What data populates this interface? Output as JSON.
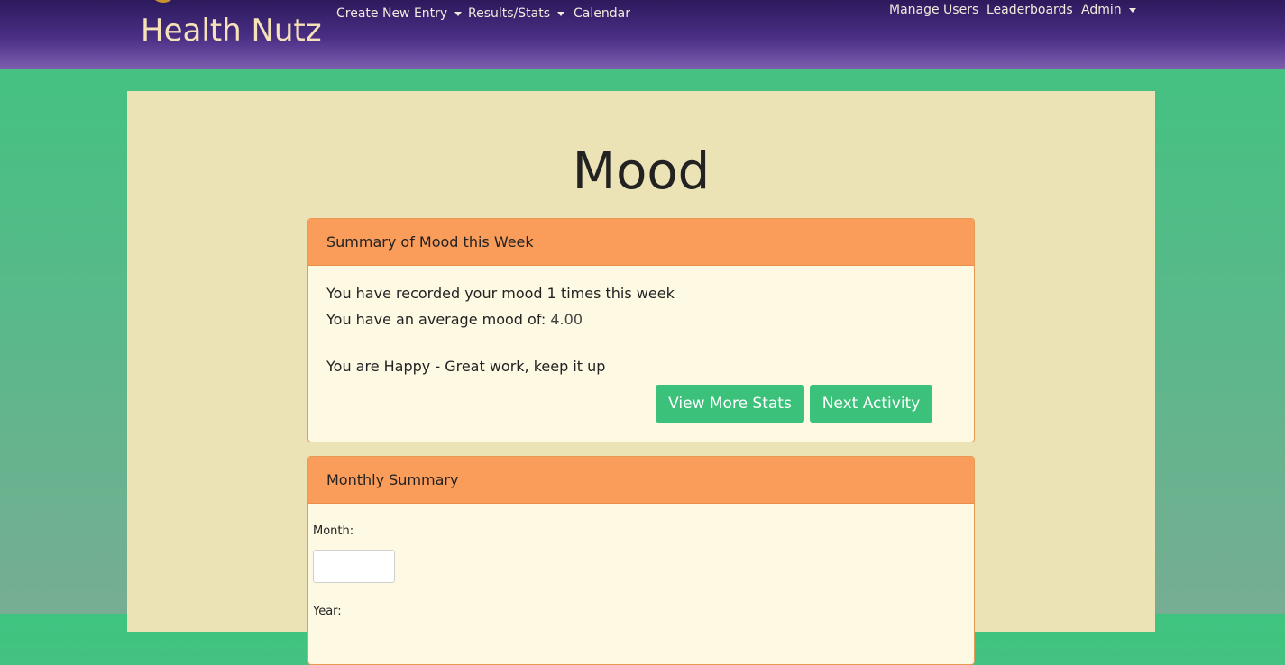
{
  "brand": {
    "name": "Health Nutz",
    "logo_icon": "sun-logo-icon"
  },
  "nav": {
    "left": [
      {
        "label": "Create New Entry",
        "dropdown": true
      },
      {
        "label": "Results/Stats",
        "dropdown": true
      },
      {
        "label": "Calendar",
        "dropdown": false
      }
    ],
    "right": [
      {
        "label": "Manage Users",
        "dropdown": false
      },
      {
        "label": "Leaderboards",
        "dropdown": false
      },
      {
        "label": "Admin",
        "dropdown": true
      }
    ]
  },
  "page": {
    "title": "Mood"
  },
  "weekly_summary": {
    "header": "Summary of Mood this Week",
    "recorded_text": "You have recorded your mood 1 times this week",
    "average_label": "You have an average mood of:",
    "average_value": "4.00",
    "status_text": "You are Happy - Great work, keep it up",
    "view_more_label": "View More Stats",
    "next_activity_label": "Next Activity"
  },
  "monthly_summary": {
    "header": "Monthly Summary",
    "month_label": "Month:",
    "month_value": "",
    "year_label": "Year:"
  },
  "colors": {
    "navbar": "#3a2470",
    "background": "#3fc47f",
    "container": "#ebe3b6",
    "card_header": "#fb9d5a",
    "button": "#3cc17a"
  }
}
